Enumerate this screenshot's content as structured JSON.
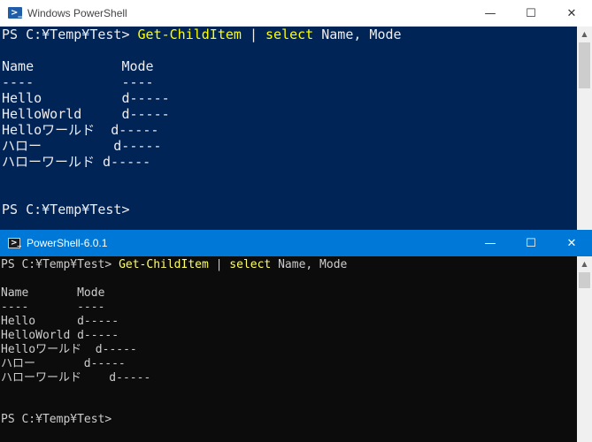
{
  "theme": {
    "win1_background": "#012456",
    "win1_text": "#eeedf0",
    "win1_command": "#ffff00",
    "win2_titlebar": "#0078d7",
    "win2_background": "#0c0c0c",
    "win2_text": "#cccccc",
    "win2_command": "#ffff66"
  },
  "window1": {
    "title": "Windows PowerShell",
    "icon": "powershell-icon",
    "controls": {
      "minimize": "—",
      "maximize": "☐",
      "close": "✕"
    },
    "prompt": "PS C:¥Temp¥Test> ",
    "command": "Get-ChildItem",
    "pipe": " | ",
    "select_cmd": "select",
    "args": " Name, Mode",
    "header": "Name           Mode",
    "underline": "----           ----",
    "rows": [
      "Hello          d-----",
      "HelloWorld     d-----",
      "Helloワールド  d-----",
      "ハロー         d-----",
      "ハローワールド d-----"
    ],
    "final_prompt": "PS C:¥Temp¥Test>"
  },
  "window2": {
    "title": "PowerShell-6.0.1",
    "icon": "powershell-core-icon",
    "controls": {
      "minimize": "—",
      "maximize": "☐",
      "close": "✕"
    },
    "prompt": "PS C:¥Temp¥Test> ",
    "command": "Get-ChildItem",
    "pipe": " | ",
    "select_cmd": "select",
    "args": " Name, Mode",
    "header": "Name       Mode",
    "underline": "----       ----",
    "rows": [
      "Hello      d-----",
      "HelloWorld d-----",
      "Helloワールド  d-----",
      "ハロー       d-----",
      "ハローワールド    d-----"
    ],
    "final_prompt": "PS C:¥Temp¥Test>"
  }
}
